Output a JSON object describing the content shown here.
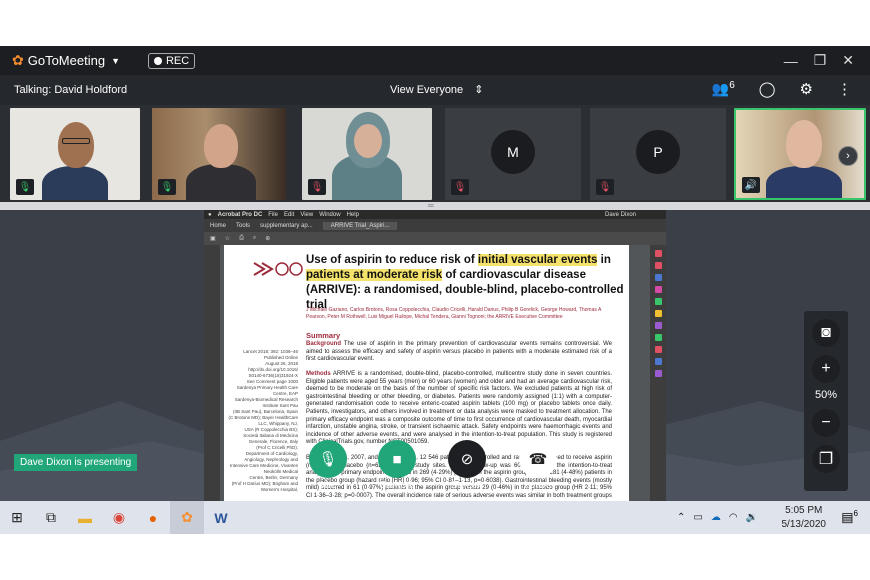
{
  "app": {
    "name": "GoToMeeting",
    "rec_label": "REC",
    "talking": "Talking: David Holdford",
    "view_label": "View Everyone",
    "participants_count": "6"
  },
  "tiles": [
    {
      "type": "video",
      "mic": "on"
    },
    {
      "type": "video",
      "mic": "on"
    },
    {
      "type": "video",
      "mic": "off"
    },
    {
      "type": "avatar",
      "initial": "M",
      "mic": "off"
    },
    {
      "type": "avatar",
      "initial": "P",
      "mic": "off"
    },
    {
      "type": "video",
      "mic": "speaking"
    }
  ],
  "shared_doc": {
    "app_bar": [
      "Acrobat Pro DC",
      "File",
      "Edit",
      "View",
      "Window",
      "Help",
      "Dave Dixon"
    ],
    "tabs": [
      "Home",
      "Tools",
      "supplementary ap...",
      "ARRIVE Trial_Aspiri..."
    ],
    "title_parts": [
      "Use of aspirin to reduce risk of ",
      "initial vascular events",
      " in ",
      "patients at moderate risk",
      " of cardiovascular disease (ARRIVE): a randomised, double-blind, placebo-controlled trial"
    ],
    "authors": "J Michael Gaziano, Carlos Brotons, Rosa Coppolecchia, Claudio Cricelli, Harald Darius, Philip B Gorelick, George Howard, Thomas A Pearson, Peter M Rothwell, Luis Miguel Ruilope, Michal Tendera, Gianni Tognoni; the ARRIVE Executive Committee",
    "summary_heading": "Summary",
    "background_label": "Background",
    "background_text": "The use of aspirin in the primary prevention of cardiovascular events remains controversial. We aimed to assess the efficacy and safety of aspirin versus placebo in patients with a moderate estimated risk of a first cardiovascular event.",
    "methods_label": "Methods",
    "methods_text": "ARRIVE is a randomised, double-blind, placebo-controlled, multicentre study done in seven countries. Eligible patients were aged 55 years (men) or 60 years (women) and older and had an average cardiovascular risk, deemed to be moderate on the basis of the number of specific risk factors. We excluded patients at high risk of gastrointestinal bleeding or other bleeding, or diabetes. Patients were randomly assigned (1:1) with a computer-generated randomisation code to receive enteric-coated aspirin tablets (100 mg) or placebo tablets once daily. Patients, investigators, and others involved in treatment or data analysis were masked to treatment allocation. The primary efficacy endpoint was a composite outcome of time to first occurrence of cardiovascular death, myocardial infarction, unstable angina, stroke, or transient ischaemic attack. Safety endpoints were haemorrhagic events and incidence of other adverse events, and were analysed in the intention-to-treat population. This study is registered with ClinicalTrials.gov, number NCT00501059.",
    "findings_text": "Between July 5, 2007, and Nov 15, 2016, 12 546 patients were enrolled and randomly assigned to receive aspirin (n=6270) or placebo (n=6276) at 501 study sites. Median follow-up was 60 months. In the intention-to-treat analysis, the primary endpoint occurred in 269 (4·29%) patients in the aspirin group versus 281 (4·48%) patients in the placebo group (hazard ratio [HR] 0·96; 95% CI 0·81–1·13, p=0·6038). Gastrointestinal bleeding events (mostly mild) occurred in 61 (0·97%) patients in the aspirin group versus 29 (0·46%) in the placebo group (HR 2·11; 95% CI 1·36–3·28; p=0·0007). The overall incidence rate of serious adverse events was similar in both treatment groups",
    "sidebar": [
      "Lancet 2018; 392: 1036–46",
      "Published Online",
      "August 26, 2018",
      "http://dx.doi.org/10.1016/",
      "S0140-6736(18)31924-X",
      "See Comment page 1000",
      "Sardenya Primary Health Care Centre, EAP",
      "Sardenya-Biomedical Research Institute Sant Pau",
      "(IIB Sant Pau), Barcelona, Spain",
      "(C Brotons MD); Bayer HealthCare LLC, Whippany, NJ,",
      "USA (R Coppolecchia BS);",
      "Società Italiana di Medicina Generale, Florence, Italy",
      "(Prof C Cricelli PhD);",
      "Department of Cardiology, Angiology, Nephrology and",
      "Intensive Care Medicine, Vivantes Neukölln Medical",
      "Centre, Berlin, Germany",
      "(Prof H Darius MD); Brigham and Women's Hospital,"
    ]
  },
  "presenter_label": "Dave Dixon is presenting",
  "controls": [
    {
      "label": "Mic",
      "color": "#21a67a"
    },
    {
      "label": "Camera",
      "color": "#21a67a"
    },
    {
      "label": "Screen",
      "color": "#1d1f23"
    },
    {
      "label": "Leave",
      "color": "#ffffff"
    }
  ],
  "zoom_level": "50%",
  "taskbar": {
    "time": "5:05 PM",
    "date": "5/13/2020",
    "notifications": "6"
  },
  "colors": {
    "accent_green": "#21a67a",
    "muted_red": "#e05065",
    "gotomeeting_orange": "#f68d2e",
    "highlight_yellow": "#f5e26b"
  }
}
